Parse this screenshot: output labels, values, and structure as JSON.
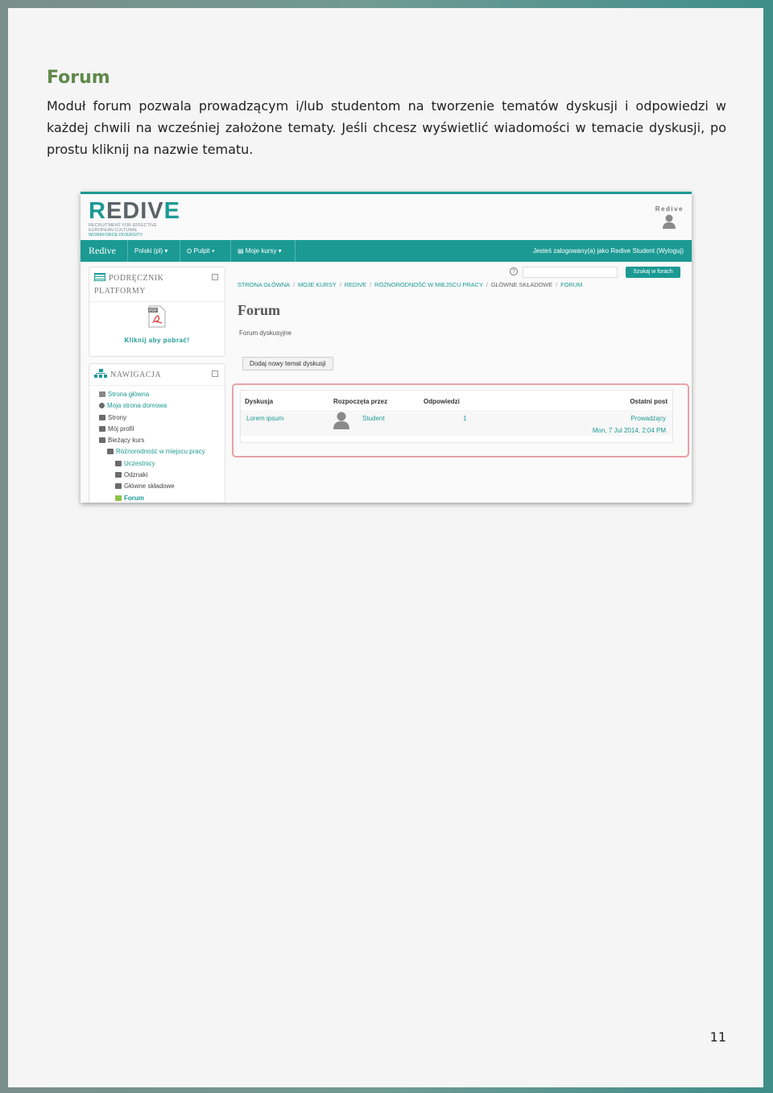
{
  "doc": {
    "title": "Forum",
    "paragraph": "Moduł forum pozwala prowadzącym i/lub studentom na tworzenie tematów dyskusji i odpowiedzi w każdej chwili na wcześniej założone tematy. Jeśli chcesz wyświetlić wiadomości w temacie dyskusji, po prostu kliknij na nazwie tematu.",
    "page_number": "11"
  },
  "screenshot": {
    "logo": {
      "word_a": "R",
      "word_b": "EDIV",
      "word_c": "E",
      "sub1": "RECRUITMENT FOR EFFECTIVE",
      "sub2": "EUROPEAN CULTURAL",
      "sub3": "WORKFORCE DIVERSITY"
    },
    "user_label": "Redive",
    "navbar": {
      "brand": "Redive",
      "lang": "Polski (pl) ▾",
      "dashboard": "Pulpit ▾",
      "my_courses": "Moje kursy ▾",
      "login_text": "Jesteś zalogowany(a) jako Redive Student (Wyloguj)"
    },
    "manual_block": {
      "title_line1": "PODRĘCZNIK",
      "title_line2": "PLATFORMY",
      "link": "Kliknij aby pobrać!"
    },
    "nav_block": {
      "title": "NAWIGACJA",
      "items": [
        "Strona główna",
        "Moja strona domowa",
        "Strony",
        "Mój profil",
        "Bieżący kurs",
        "Różnorodność w miejscu pracy",
        "Uczestnicy",
        "Odznaki",
        "Główne składowe",
        "Forum"
      ]
    },
    "search_button": "Szukaj w forach",
    "breadcrumb": [
      "STRONA GŁÓWNA",
      "MOJE KURSY",
      "REDIVE",
      "RÓŻNORODNOŚĆ W MIEJSCU PRACY",
      "GŁÓWNE SKŁADOWE",
      "FORUM"
    ],
    "forum_heading": "Forum",
    "forum_subtitle": "Forum dyskusyjne",
    "add_topic_button": "Dodaj nowy temat dyskusji",
    "table": {
      "headers": [
        "Dyskusja",
        "Rozpoczęta przez",
        "Odpowiedzi",
        "Ostatni post"
      ],
      "row": {
        "discussion": "Lorem ipsum",
        "started_by": "Student",
        "replies": "1",
        "last_post_author": "Prowadzący",
        "last_post_date": "Mon, 7 Jul 2014, 2:04 PM"
      }
    }
  }
}
